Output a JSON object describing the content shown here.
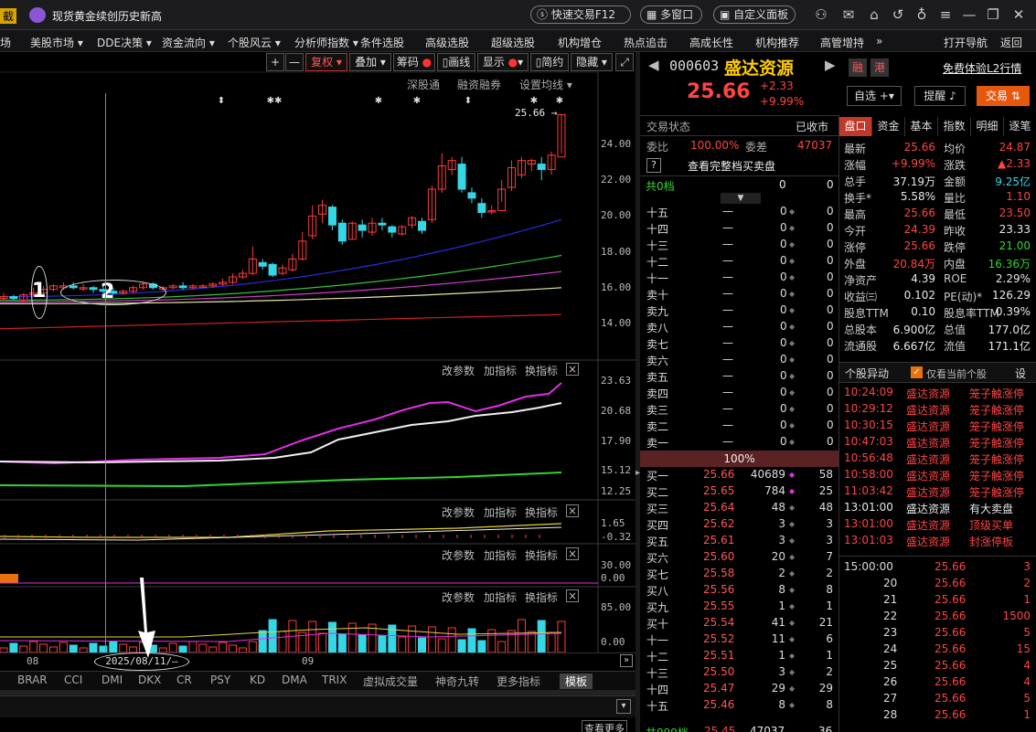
{
  "topbar": {
    "left_tag": "截",
    "news": "现货黄金续创历史新高",
    "quick_trade": "快速交易F12",
    "multi_window": "多窗口",
    "custom_panel": "自定义面板"
  },
  "menu": [
    "场",
    "美股市场",
    "DDE决策",
    "资金流向",
    "个股风云",
    "分析师指数",
    "条件选股",
    "高级选股",
    "超级选股",
    "机构增仓",
    "热点追击",
    "高成长性",
    "机构推荐",
    "高管增持"
  ],
  "menu_right": {
    "more": "»",
    "open_nav": "打开导航",
    "back": "返回"
  },
  "chart_toolbar": {
    "plus": "+",
    "minus": "—",
    "fq": "复权",
    "overlay": "叠加",
    "chip": "筹码",
    "draw": "画线",
    "display": "显示",
    "simple": "简约",
    "hide": "隐藏"
  },
  "chart_links": {
    "shengu": "深股通",
    "rzrq": "融资融券",
    "ma_setting": "设置均线"
  },
  "price_axis": [
    "24.00",
    "22.00",
    "20.00",
    "18.00",
    "16.00",
    "14.00"
  ],
  "last_price_label": "25.66",
  "sub1": {
    "axis": [
      "23.63",
      "20.68",
      "17.90",
      "15.12",
      "12.25"
    ]
  },
  "sub2": {
    "axis": [
      "1.65",
      "-0.32"
    ]
  },
  "sub3": {
    "axis": [
      "30.00",
      "0.00"
    ]
  },
  "sub4": {
    "axis": [
      "85.00",
      "0.00"
    ]
  },
  "ind_buttons": {
    "change_param": "改参数",
    "add_ind": "加指标",
    "swap_ind": "换指标",
    "close": "×"
  },
  "x_axis": {
    "aug": "08",
    "sep": "09",
    "cursor_date": "2025/08/11/—"
  },
  "annotations": {
    "one": "1",
    "two": "2"
  },
  "bottom_tabs": [
    "BRAR",
    "CCI",
    "DMI",
    "DKX",
    "CR",
    "PSY",
    "KD",
    "DMA",
    "TRIX",
    "虚拟成交量",
    "神奇九转",
    "更多指标",
    "模板"
  ],
  "bottom_view_more": "查看更多",
  "stock": {
    "code": "000603",
    "name": "盛达资源",
    "price": "25.66",
    "change": "+2.33",
    "pct": "+9.99%",
    "rong": "融",
    "gang": "港",
    "l2_link": "免费体验L2行情",
    "zixuan": "自选",
    "tixing": "提醒",
    "jiaoyi": "交易"
  },
  "trade_status": {
    "label": "交易状态",
    "value": "已收市"
  },
  "weibi": {
    "label": "委比",
    "value": "100.00%",
    "cha_label": "委差",
    "cha_value": "47037"
  },
  "full_book": "查看完整档买卖盘",
  "total_row": {
    "label": "共0档",
    "v1": "0",
    "v2": "0"
  },
  "asks": [
    {
      "l": "十五",
      "p": "—",
      "v": "0",
      "c": "0"
    },
    {
      "l": "十四",
      "p": "—",
      "v": "0",
      "c": "0"
    },
    {
      "l": "十三",
      "p": "—",
      "v": "0",
      "c": "0"
    },
    {
      "l": "十二",
      "p": "—",
      "v": "0",
      "c": "0"
    },
    {
      "l": "十一",
      "p": "—",
      "v": "0",
      "c": "0"
    },
    {
      "l": "卖十",
      "p": "—",
      "v": "0",
      "c": "0"
    },
    {
      "l": "卖九",
      "p": "—",
      "v": "0",
      "c": "0"
    },
    {
      "l": "卖八",
      "p": "—",
      "v": "0",
      "c": "0"
    },
    {
      "l": "卖七",
      "p": "—",
      "v": "0",
      "c": "0"
    },
    {
      "l": "卖六",
      "p": "—",
      "v": "0",
      "c": "0"
    },
    {
      "l": "卖五",
      "p": "—",
      "v": "0",
      "c": "0"
    },
    {
      "l": "卖四",
      "p": "—",
      "v": "0",
      "c": "0"
    },
    {
      "l": "卖三",
      "p": "—",
      "v": "0",
      "c": "0"
    },
    {
      "l": "卖二",
      "p": "—",
      "v": "0",
      "c": "0"
    },
    {
      "l": "卖一",
      "p": "—",
      "v": "0",
      "c": "0"
    }
  ],
  "bid_ratio": "100%",
  "bids": [
    {
      "l": "买一",
      "p": "25.66",
      "v": "40689",
      "c": "58"
    },
    {
      "l": "买二",
      "p": "25.65",
      "v": "784",
      "c": "25"
    },
    {
      "l": "买三",
      "p": "25.64",
      "v": "48",
      "c": "48"
    },
    {
      "l": "买四",
      "p": "25.62",
      "v": "3",
      "c": "3"
    },
    {
      "l": "买五",
      "p": "25.61",
      "v": "3",
      "c": "3"
    },
    {
      "l": "买六",
      "p": "25.60",
      "v": "20",
      "c": "7"
    },
    {
      "l": "买七",
      "p": "25.58",
      "v": "2",
      "c": "2"
    },
    {
      "l": "买八",
      "p": "25.56",
      "v": "8",
      "c": "8"
    },
    {
      "l": "买九",
      "p": "25.55",
      "v": "1",
      "c": "1"
    },
    {
      "l": "买十",
      "p": "25.54",
      "v": "41",
      "c": "21"
    },
    {
      "l": "十一",
      "p": "25.52",
      "v": "11",
      "c": "6"
    },
    {
      "l": "十二",
      "p": "25.51",
      "v": "1",
      "c": "1"
    },
    {
      "l": "十三",
      "p": "25.50",
      "v": "3",
      "c": "2"
    },
    {
      "l": "十四",
      "p": "25.47",
      "v": "29",
      "c": "29"
    },
    {
      "l": "十五",
      "p": "25.46",
      "v": "8",
      "c": "8"
    }
  ],
  "bottom_row": {
    "label": "共999档",
    "p": "25.45",
    "v": "47037",
    "c": "36"
  },
  "right_tabs": [
    "盘口",
    "资金",
    "基本",
    "指数",
    "明细",
    "逐笔"
  ],
  "quote": [
    {
      "l1": "最新",
      "v1": "25.66",
      "c1": "red",
      "l2": "均价",
      "v2": "24.87",
      "c2": "red"
    },
    {
      "l1": "涨幅",
      "v1": "+9.99%",
      "c1": "red",
      "l2": "涨跌",
      "v2": "▲2.33",
      "c2": "red"
    },
    {
      "l1": "总手",
      "v1": "37.19万",
      "c1": "wht",
      "l2": "金额",
      "v2": "9.25亿",
      "c2": "cyn"
    },
    {
      "l1": "换手*",
      "v1": "5.58%",
      "c1": "wht",
      "l2": "量比",
      "v2": "1.10",
      "c2": "red"
    },
    {
      "l1": "最高",
      "v1": "25.66",
      "c1": "red",
      "l2": "最低",
      "v2": "23.50",
      "c2": "red"
    },
    {
      "l1": "今开",
      "v1": "24.39",
      "c1": "red",
      "l2": "昨收",
      "v2": "23.33",
      "c2": "wht"
    },
    {
      "l1": "涨停",
      "v1": "25.66",
      "c1": "red",
      "l2": "跌停",
      "v2": "21.00",
      "c2": "grn"
    },
    {
      "l1": "外盘",
      "v1": "20.84万",
      "c1": "red",
      "l2": "内盘",
      "v2": "16.36万",
      "c2": "grn"
    },
    {
      "l1": "净资产",
      "v1": "4.39",
      "c1": "wht",
      "l2": "ROE",
      "v2": "2.29%",
      "c2": "wht"
    },
    {
      "l1": "收益㈢",
      "v1": "0.102",
      "c1": "wht",
      "l2": "PE(动)*",
      "v2": "126.29",
      "c2": "wht"
    },
    {
      "l1": "股息TTM",
      "v1": "0.10",
      "c1": "wht",
      "l2": "股息率TTM",
      "v2": "0.39%",
      "c2": "wht"
    },
    {
      "l1": "总股本",
      "v1": "6.900亿",
      "c1": "wht",
      "l2": "总值",
      "v2": "177.0亿",
      "c2": "wht"
    },
    {
      "l1": "流通股",
      "v1": "6.667亿",
      "c1": "wht",
      "l2": "流值",
      "v2": "171.1亿",
      "c2": "wht"
    }
  ],
  "events_header": {
    "title": "个股异动",
    "only_current": "仅看当前个股",
    "settings": "设"
  },
  "events": [
    {
      "t": "10:24:09",
      "n": "盛达资源",
      "e": "笼子触涨停",
      "c": "red"
    },
    {
      "t": "10:29:12",
      "n": "盛达资源",
      "e": "笼子触涨停",
      "c": "red"
    },
    {
      "t": "10:30:15",
      "n": "盛达资源",
      "e": "笼子触涨停",
      "c": "red"
    },
    {
      "t": "10:47:03",
      "n": "盛达资源",
      "e": "笼子触涨停",
      "c": "red"
    },
    {
      "t": "10:56:48",
      "n": "盛达资源",
      "e": "笼子触涨停",
      "c": "red"
    },
    {
      "t": "10:58:00",
      "n": "盛达资源",
      "e": "笼子触涨停",
      "c": "red"
    },
    {
      "t": "11:03:42",
      "n": "盛达资源",
      "e": "笼子触涨停",
      "c": "red"
    },
    {
      "t": "13:01:00",
      "n": "盛达资源",
      "e": "有大卖盘",
      "c": "wht"
    },
    {
      "t": "13:01:00",
      "n": "盛达资源",
      "e": "顶级买单",
      "c": "red"
    },
    {
      "t": "13:01:03",
      "n": "盛达资源",
      "e": "封涨停板",
      "c": "red"
    }
  ],
  "ticks": [
    {
      "t": "15:00:00",
      "p": "25.66",
      "v": "3"
    },
    {
      "t": "20",
      "p": "25.66",
      "v": "2"
    },
    {
      "t": "21",
      "p": "25.66",
      "v": "1"
    },
    {
      "t": "22",
      "p": "25.66",
      "v": "1500"
    },
    {
      "t": "23",
      "p": "25.66",
      "v": "5"
    },
    {
      "t": "24",
      "p": "25.66",
      "v": "15"
    },
    {
      "t": "25",
      "p": "25.66",
      "v": "4"
    },
    {
      "t": "26",
      "p": "25.66",
      "v": "4"
    },
    {
      "t": "27",
      "p": "25.66",
      "v": "5"
    },
    {
      "t": "28",
      "p": "25.66",
      "v": "1"
    }
  ],
  "chart_data": {
    "type": "candlestick",
    "price_axis_ticks": [
      24,
      22,
      20,
      18,
      16,
      14
    ],
    "ylim": [
      13.4,
      26.2
    ],
    "candles": [
      {
        "o": 15.4,
        "c": 15.5,
        "h": 15.7,
        "l": 15.3
      },
      {
        "o": 15.5,
        "c": 15.4,
        "h": 15.6,
        "l": 15.3
      },
      {
        "o": 15.3,
        "c": 15.6,
        "h": 15.7,
        "l": 15.2
      },
      {
        "o": 15.6,
        "c": 15.7,
        "h": 16.0,
        "l": 15.5
      },
      {
        "o": 15.7,
        "c": 15.9,
        "h": 16.1,
        "l": 15.6
      },
      {
        "o": 15.9,
        "c": 16.1,
        "h": 16.2,
        "l": 15.8
      },
      {
        "o": 16.0,
        "c": 16.1,
        "h": 16.3,
        "l": 15.9
      },
      {
        "o": 16.1,
        "c": 16.0,
        "h": 16.3,
        "l": 15.9
      },
      {
        "o": 16.0,
        "c": 16.0,
        "h": 16.2,
        "l": 15.8
      },
      {
        "o": 16.0,
        "c": 15.9,
        "h": 16.1,
        "l": 15.7
      },
      {
        "o": 15.9,
        "c": 15.8,
        "h": 16.1,
        "l": 15.6
      },
      {
        "o": 15.8,
        "c": 15.7,
        "h": 16.0,
        "l": 15.6
      },
      {
        "o": 15.7,
        "c": 15.8,
        "h": 15.9,
        "l": 15.6
      },
      {
        "o": 15.8,
        "c": 16.0,
        "h": 16.1,
        "l": 15.7
      },
      {
        "o": 16.0,
        "c": 16.2,
        "h": 16.3,
        "l": 15.9
      },
      {
        "o": 16.2,
        "c": 16.0,
        "h": 16.3,
        "l": 15.9
      },
      {
        "o": 16.0,
        "c": 16.0,
        "h": 16.1,
        "l": 15.8
      },
      {
        "o": 16.0,
        "c": 16.1,
        "h": 16.2,
        "l": 15.9
      },
      {
        "o": 16.1,
        "c": 16.0,
        "h": 16.3,
        "l": 15.9
      },
      {
        "o": 16.0,
        "c": 16.1,
        "h": 16.2,
        "l": 15.9
      },
      {
        "o": 16.1,
        "c": 16.1,
        "h": 16.2,
        "l": 16.0
      },
      {
        "o": 16.1,
        "c": 16.2,
        "h": 16.3,
        "l": 16.0
      },
      {
        "o": 16.2,
        "c": 16.3,
        "h": 16.5,
        "l": 16.1
      },
      {
        "o": 16.3,
        "c": 16.6,
        "h": 16.8,
        "l": 16.2
      },
      {
        "o": 16.6,
        "c": 16.8,
        "h": 17.0,
        "l": 16.5
      },
      {
        "o": 16.8,
        "c": 17.6,
        "h": 18.3,
        "l": 16.7
      },
      {
        "o": 17.4,
        "c": 17.2,
        "h": 17.6,
        "l": 17.0
      },
      {
        "o": 17.3,
        "c": 16.7,
        "h": 17.4,
        "l": 16.6
      },
      {
        "o": 16.8,
        "c": 17.1,
        "h": 17.3,
        "l": 16.7
      },
      {
        "o": 17.0,
        "c": 17.6,
        "h": 17.9,
        "l": 16.9
      },
      {
        "o": 17.6,
        "c": 18.6,
        "h": 19.1,
        "l": 17.5
      },
      {
        "o": 18.9,
        "c": 20.0,
        "h": 20.6,
        "l": 18.7
      },
      {
        "o": 20.1,
        "c": 20.6,
        "h": 20.9,
        "l": 19.6
      },
      {
        "o": 20.5,
        "c": 19.5,
        "h": 20.6,
        "l": 19.2
      },
      {
        "o": 19.6,
        "c": 18.6,
        "h": 19.8,
        "l": 18.4
      },
      {
        "o": 18.7,
        "c": 19.6,
        "h": 19.7,
        "l": 18.7
      },
      {
        "o": 19.5,
        "c": 19.2,
        "h": 19.8,
        "l": 18.8
      },
      {
        "o": 19.1,
        "c": 19.6,
        "h": 19.9,
        "l": 18.9
      },
      {
        "o": 19.6,
        "c": 19.5,
        "h": 19.9,
        "l": 19.2
      },
      {
        "o": 19.4,
        "c": 19.1,
        "h": 19.5,
        "l": 18.8
      },
      {
        "o": 19.0,
        "c": 19.4,
        "h": 19.5,
        "l": 18.9
      },
      {
        "o": 19.5,
        "c": 19.9,
        "h": 20.0,
        "l": 19.3
      },
      {
        "o": 19.7,
        "c": 19.2,
        "h": 19.9,
        "l": 19.0
      },
      {
        "o": 19.8,
        "c": 21.5,
        "h": 21.7,
        "l": 19.6
      },
      {
        "o": 21.5,
        "c": 22.8,
        "h": 23.5,
        "l": 21.3
      },
      {
        "o": 22.6,
        "c": 23.1,
        "h": 23.3,
        "l": 22.3
      },
      {
        "o": 22.9,
        "c": 21.5,
        "h": 23.3,
        "l": 21.3
      },
      {
        "o": 21.3,
        "c": 21.0,
        "h": 21.6,
        "l": 20.7
      },
      {
        "o": 20.7,
        "c": 20.2,
        "h": 21.0,
        "l": 19.9
      },
      {
        "o": 20.3,
        "c": 20.3,
        "h": 20.6,
        "l": 20.1
      },
      {
        "o": 20.3,
        "c": 21.5,
        "h": 22.0,
        "l": 20.8
      },
      {
        "o": 21.6,
        "c": 22.7,
        "h": 23.1,
        "l": 21.4
      },
      {
        "o": 22.3,
        "c": 23.1,
        "h": 23.3,
        "l": 22.1
      },
      {
        "o": 22.9,
        "c": 23.1,
        "h": 23.2,
        "l": 22.5
      },
      {
        "o": 22.9,
        "c": 22.6,
        "h": 23.3,
        "l": 22.0
      },
      {
        "o": 22.6,
        "c": 23.4,
        "h": 23.6,
        "l": 22.3
      },
      {
        "o": 23.3,
        "c": 25.66,
        "h": 25.66,
        "l": 23.5
      }
    ],
    "ma": [
      {
        "color": "#2b2be0",
        "start": 15.5,
        "end": 19.8
      },
      {
        "color": "#33c433",
        "start": 15.3,
        "end": 17.8
      },
      {
        "color": "#d13ad1",
        "start": 15.2,
        "end": 16.9
      },
      {
        "color": "#e8e8a0",
        "start": 15.1,
        "end": 16.0
      },
      {
        "color": "#cc2222",
        "start": 13.7,
        "end": 14.5
      }
    ]
  }
}
